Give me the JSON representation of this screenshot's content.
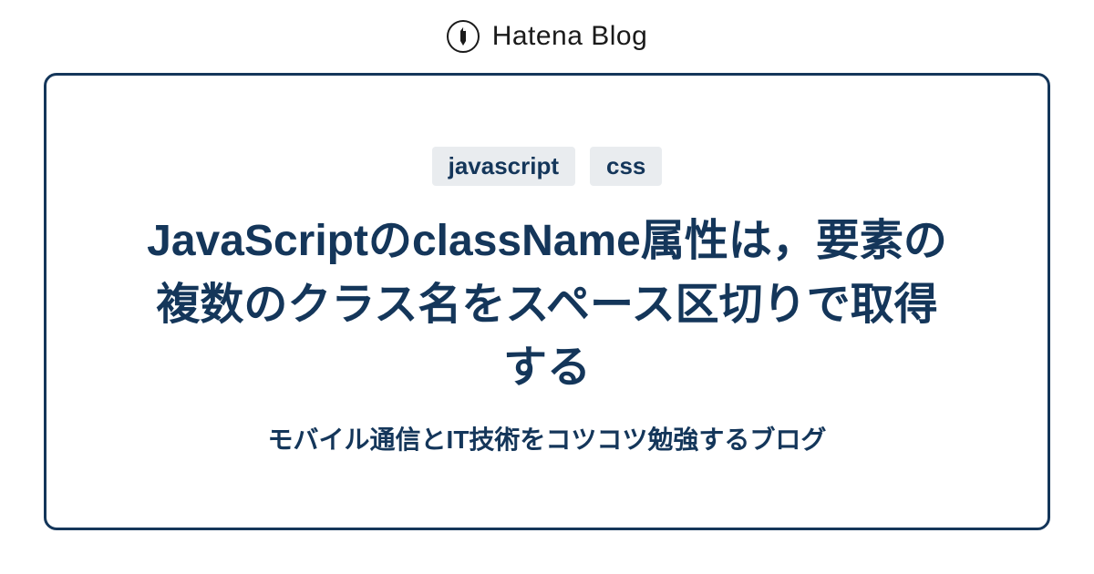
{
  "header": {
    "brand": "Hatena Blog"
  },
  "card": {
    "tags": [
      "javascript",
      "css"
    ],
    "title": "JavaScriptのclassName属性は，要素の複数のクラス名をスペース区切りで取得する",
    "subtitle": "モバイル通信とIT技術をコツコツ勉強するブログ"
  },
  "colors": {
    "accent": "#14365a",
    "tag_bg": "#e9ecef",
    "text_dark": "#1a1a1a"
  }
}
